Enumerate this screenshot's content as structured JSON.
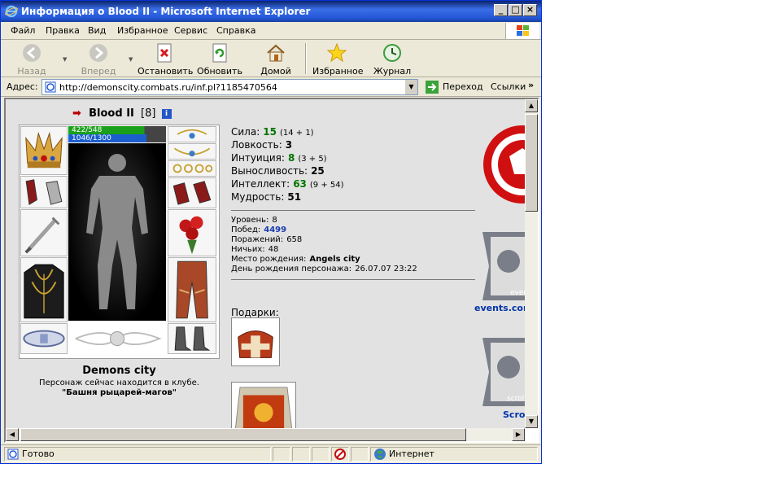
{
  "window": {
    "title": "Информация о Blood II - Microsoft Internet Explorer",
    "min_label": "_",
    "max_label": "□",
    "close_label": "×"
  },
  "menu": [
    "Файл",
    "Правка",
    "Вид",
    "Избранное",
    "Сервис",
    "Справка"
  ],
  "toolbar": {
    "back": "Назад",
    "forward": "Вперед",
    "stop": "Остановить",
    "refresh": "Обновить",
    "home": "Домой",
    "favorites": "Избранное",
    "history": "Журнал"
  },
  "address": {
    "label": "Адрес:",
    "url": "http://demonscity.combats.ru/inf.pl?1185470564",
    "go": "Переход",
    "links": "Ссылки",
    "links_chevron": "»"
  },
  "character": {
    "name": "Blood II",
    "level": "[8]",
    "info_icon_label": "i",
    "hp": "422/548",
    "mp": "1046/1300",
    "city": "Demons city",
    "club_note": "Персонаж сейчас находится в клубе.",
    "club_place": "\"Башня рыцарей-магов\""
  },
  "stats": [
    {
      "label": "Сила:",
      "value": "15",
      "bonus": "(14 + 1)",
      "green": true
    },
    {
      "label": "Ловкость:",
      "value": "3",
      "bonus": "",
      "green": false
    },
    {
      "label": "Интуиция:",
      "value": "8",
      "bonus": "(3 + 5)",
      "green": true
    },
    {
      "label": "Выносливость:",
      "value": "25",
      "bonus": "",
      "green": false
    },
    {
      "label": "Интеллект:",
      "value": "63",
      "bonus": "(9 + 54)",
      "green": true
    },
    {
      "label": "Мудрость:",
      "value": "51",
      "bonus": "",
      "green": false
    }
  ],
  "info": [
    {
      "label": "Уровень:",
      "value": "8",
      "style": ""
    },
    {
      "label": "Побед:",
      "value": "4499",
      "style": "blue"
    },
    {
      "label": "Поражений:",
      "value": "658",
      "style": ""
    },
    {
      "label": "Ничьих:",
      "value": "48",
      "style": ""
    },
    {
      "label": "Место рождения:",
      "value": "Angels city",
      "style": "bold"
    },
    {
      "label": "День рождения персонажа:",
      "value": "26.07.07 23:22",
      "style": ""
    }
  ],
  "gifts_title": "Подарки:",
  "banners": {
    "events_link": "events.com",
    "events_caption": "events",
    "scroll_link": "Scroll",
    "scroll_caption": "scroll"
  },
  "status": {
    "text": "Готово",
    "zone": "Интернет"
  },
  "colors": {
    "accent": "#0a246a",
    "stat_green": "#007500",
    "link_blue": "#0033aa",
    "banner_red": "#d01010"
  }
}
